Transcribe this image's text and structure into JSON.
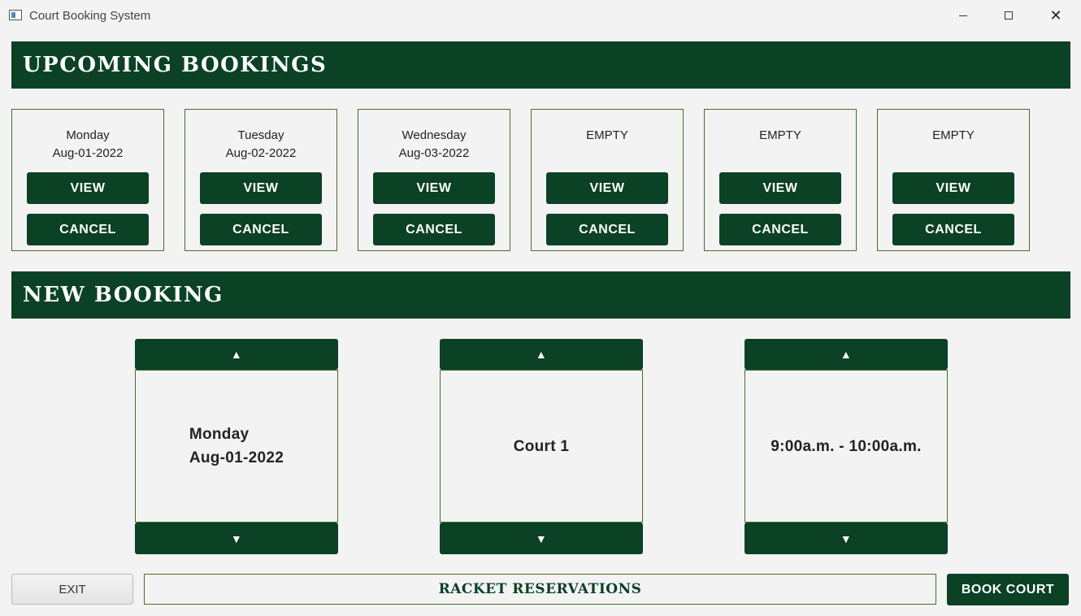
{
  "window": {
    "title": "Court Booking System",
    "controls": {
      "minimize": "minimize-icon",
      "maximize": "maximize-icon",
      "close": "✕"
    }
  },
  "upcoming": {
    "header": "UPCOMING BOOKINGS",
    "cards": [
      {
        "line1": "Monday",
        "line2": "Aug-01-2022",
        "view_label": "VIEW",
        "cancel_label": "CANCEL"
      },
      {
        "line1": "Tuesday",
        "line2": "Aug-02-2022",
        "view_label": "VIEW",
        "cancel_label": "CANCEL"
      },
      {
        "line1": "Wednesday",
        "line2": "Aug-03-2022",
        "view_label": "VIEW",
        "cancel_label": "CANCEL"
      },
      {
        "line1": "EMPTY",
        "line2": "",
        "view_label": "VIEW",
        "cancel_label": "CANCEL"
      },
      {
        "line1": "EMPTY",
        "line2": "",
        "view_label": "VIEW",
        "cancel_label": "CANCEL"
      },
      {
        "line1": "EMPTY",
        "line2": "",
        "view_label": "VIEW",
        "cancel_label": "CANCEL"
      }
    ]
  },
  "new_booking": {
    "header": "NEW BOOKING",
    "up_arrow": "▲",
    "down_arrow": "▼",
    "date": {
      "line1": "Monday",
      "line2": "Aug-01-2022"
    },
    "court": "Court 1",
    "time": "9:00a.m. - 10:00a.m."
  },
  "footer": {
    "exit_label": "EXIT",
    "brand": "RACKET RESERVATIONS",
    "book_label": "BOOK COURT"
  },
  "colors": {
    "primary": "#0b4125",
    "border": "#4b6a2a",
    "background": "#f3f3f3"
  }
}
